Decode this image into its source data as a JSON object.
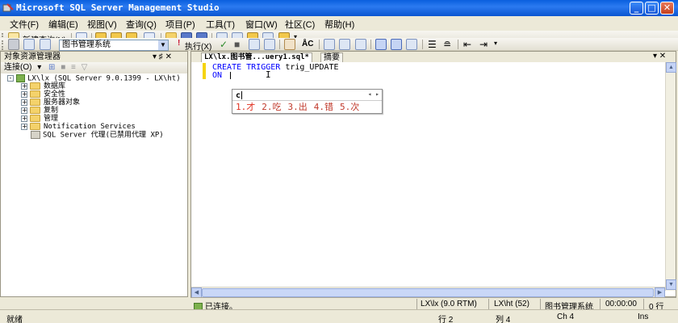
{
  "window": {
    "title": "Microsoft SQL Server Management Studio",
    "minimize": "_",
    "maximize": "□",
    "close": "✕"
  },
  "menu": [
    "文件(F)",
    "编辑(E)",
    "视图(V)",
    "查询(Q)",
    "项目(P)",
    "工具(T)",
    "窗口(W)",
    "社区(C)",
    "帮助(H)"
  ],
  "toolbar1": {
    "new_query": "新建查询(N)"
  },
  "toolbar2": {
    "database": "图书管理系统",
    "execute": "执行(X)"
  },
  "object_explorer": {
    "title": "对象资源管理器",
    "pin": "▾ ♯ ✕",
    "connect": "连接(O)",
    "root": "LX\\lx (SQL Server 9.0.1399 - LX\\ht)",
    "expand_root": "-",
    "expand": "+",
    "nodes": [
      "数据库",
      "安全性",
      "服务器对象",
      "复制",
      "管理",
      "Notification Services"
    ],
    "agent": "SQL Server 代理(已禁用代理 XP)"
  },
  "editor": {
    "tab_active": "LX\\lx.图书管...uery1.sql*",
    "tab_summary": "摘要",
    "tab_controls": "▾ ✕",
    "code": {
      "line1_kw": "CREATE TRIGGER",
      "line1_name": " trig_UPDATE",
      "line2_kw": "ON"
    },
    "ibeam": "I"
  },
  "ime": {
    "composition": "c",
    "arrows": "◂ ▸",
    "candidates": [
      "1.才",
      "2.吃",
      "3.出",
      "4.错",
      "5.次"
    ]
  },
  "connection_bar": {
    "status": "已连接。",
    "server": "LX\\lx (9.0 RTM)",
    "user": "LX\\ht (52)",
    "database": "图书管理系统",
    "time": "00:00:00",
    "rows": "0 行"
  },
  "status_bar": {
    "ready": "就绪",
    "line": "行 2",
    "col": "列 4",
    "ch": "Ch 4",
    "mode": "Ins"
  }
}
